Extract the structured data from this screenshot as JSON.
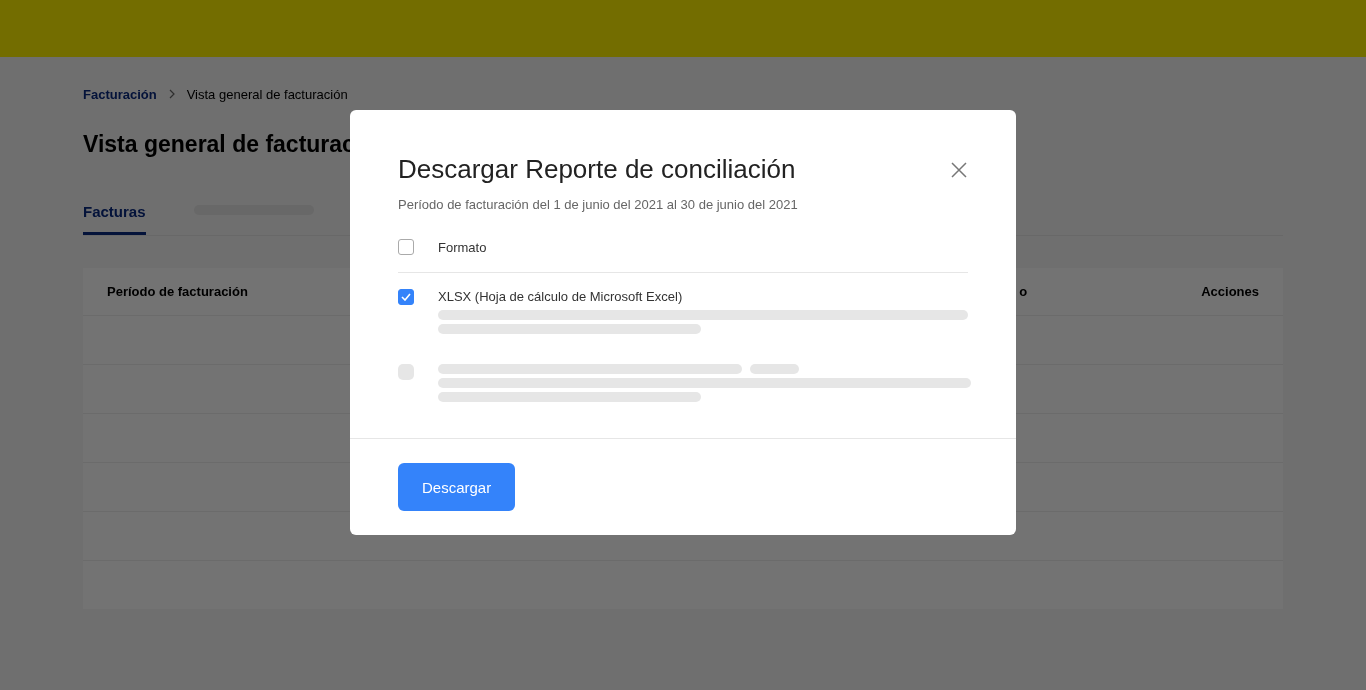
{
  "breadcrumb": [
    {
      "label": "Facturación",
      "kind": "link"
    },
    {
      "label": "Vista general de facturación",
      "kind": "current"
    }
  ],
  "page_title": "Vista general de facturac",
  "tabs": [
    {
      "label": "Facturas",
      "selected": true
    }
  ],
  "table": {
    "columns": [
      "Período de facturación",
      "o",
      "Acciones"
    ]
  },
  "modal": {
    "title": "Descargar Reporte de conciliación",
    "subtitle": "Período de facturación del 1 de junio del 2021 al 30 de junio del 2021",
    "select_all": {
      "label": "Formato",
      "checked": false
    },
    "options": [
      {
        "kind": "format",
        "label": "XLSX (Hoja de cálculo de Microsoft Excel)",
        "checked": true
      },
      {
        "kind": "loading"
      }
    ],
    "button": "Descargar"
  }
}
